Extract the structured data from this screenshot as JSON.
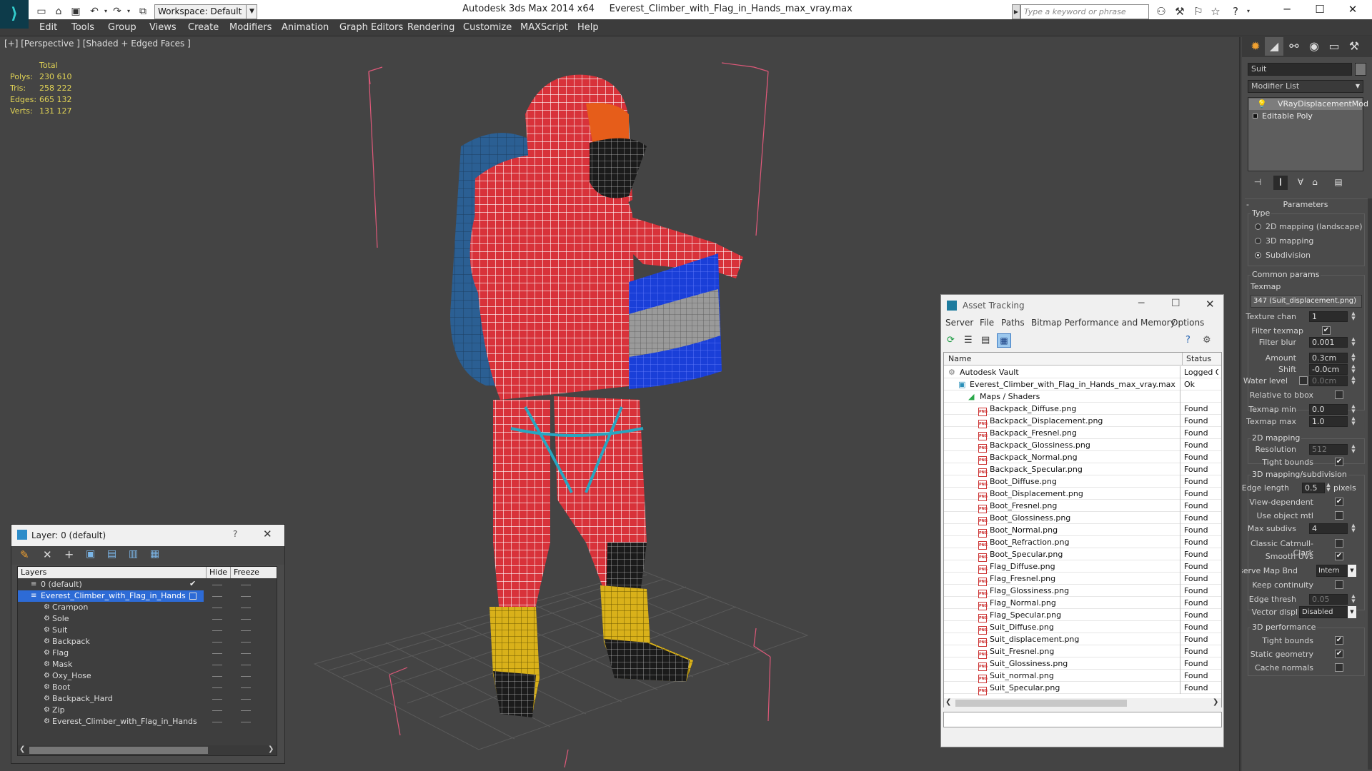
{
  "titlebar": {
    "app_title": "Autodesk 3ds Max  2014 x64",
    "file_name": "Everest_Climber_with_Flag_in_Hands_max_vray.max",
    "workspace": "Workspace: Default",
    "search_placeholder": "Type a keyword or phrase"
  },
  "menu": [
    "Edit",
    "Tools",
    "Group",
    "Views",
    "Create",
    "Modifiers",
    "Animation",
    "Graph Editors",
    "Rendering",
    "Customize",
    "MAXScript",
    "Help"
  ],
  "viewport": {
    "label": "[+] [Perspective ] [Shaded + Edged Faces ]",
    "stats": {
      "header": "Total",
      "rows": [
        {
          "label": "Polys:",
          "value": "230 610"
        },
        {
          "label": "Tris:",
          "value": "258 222"
        },
        {
          "label": "Edges:",
          "value": "665 132"
        },
        {
          "label": "Verts:",
          "value": "131 127"
        }
      ]
    }
  },
  "command_panel": {
    "object_name": "Suit",
    "modifier_list": "Modifier List",
    "stack": [
      "VRayDisplacementMod",
      "Editable Poly"
    ],
    "parameters": {
      "title": "Parameters",
      "type_label": "Type",
      "types": [
        "2D mapping (landscape)",
        "3D mapping",
        "Subdivision"
      ],
      "selected_type": 2,
      "common_label": "Common params",
      "texmap_label": "Texmap",
      "texmap_value": "347 (Suit_displacement.png)",
      "texture_chan_label": "Texture chan",
      "texture_chan": "1",
      "filter_texmap_label": "Filter texmap",
      "filter_blur_label": "Filter blur",
      "filter_blur": "0.001",
      "amount_label": "Amount",
      "amount": "0.3cm",
      "shift_label": "Shift",
      "shift": "-0.0cm",
      "water_level_label": "Water level",
      "water_level": "0.0cm",
      "relative_bbox_label": "Relative to bbox",
      "texmap_min_label": "Texmap min",
      "texmap_min": "0.0",
      "texmap_max_label": "Texmap max",
      "texmap_max": "1.0",
      "mapping2d_label": "2D mapping",
      "resolution_label": "Resolution",
      "resolution": "512",
      "tight_bounds_label": "Tight bounds",
      "mapping3d_label": "3D mapping/subdivision",
      "edge_length_label": "Edge length",
      "edge_length": "0.5",
      "pixels_label": "pixels",
      "view_dependent_label": "View-dependent",
      "use_object_mtl_label": "Use object mtl",
      "max_subdivs_label": "Max subdivs",
      "max_subdivs": "4",
      "catmull_label": "Classic Catmull-Clark",
      "smooth_uvs_label": "Smooth UVs",
      "preserve_label": "Preserve Map Bnd",
      "preserve_value": "Intern",
      "keep_continuity_label": "Keep continuity",
      "edge_thresh_label": "Edge thresh",
      "edge_thresh": "0.05",
      "vector_disp_label": "Vector displ",
      "vector_disp_value": "Disabled",
      "perf_label": "3D performance",
      "perf_tight_label": "Tight bounds",
      "static_geom_label": "Static geometry",
      "cache_normals_label": "Cache normals"
    }
  },
  "layers": {
    "title": "Layer: 0 (default)",
    "help": "?",
    "col_layers": "Layers",
    "col_hide": "Hide",
    "col_freeze": "Freeze",
    "rows": [
      {
        "name": "0 (default)",
        "level": 0,
        "kind": "layer"
      },
      {
        "name": "Everest_Climber_with_Flag_in_Hands",
        "level": 0,
        "kind": "layer",
        "selected": true
      },
      {
        "name": "Crampon",
        "level": 1,
        "kind": "object"
      },
      {
        "name": "Sole",
        "level": 1,
        "kind": "object"
      },
      {
        "name": "Suit",
        "level": 1,
        "kind": "object"
      },
      {
        "name": "Backpack",
        "level": 1,
        "kind": "object"
      },
      {
        "name": "Flag",
        "level": 1,
        "kind": "object"
      },
      {
        "name": "Mask",
        "level": 1,
        "kind": "object"
      },
      {
        "name": "Oxy_Hose",
        "level": 1,
        "kind": "object"
      },
      {
        "name": "Boot",
        "level": 1,
        "kind": "object"
      },
      {
        "name": "Backpack_Hard",
        "level": 1,
        "kind": "object"
      },
      {
        "name": "Zip",
        "level": 1,
        "kind": "object"
      },
      {
        "name": "Everest_Climber_with_Flag_in_Hands",
        "level": 1,
        "kind": "object"
      }
    ]
  },
  "asset_tracking": {
    "title": "Asset Tracking",
    "menu": [
      "Server",
      "File",
      "Paths",
      "Bitmap Performance and Memory",
      "Options"
    ],
    "col_name": "Name",
    "col_status": "Status",
    "rows": [
      {
        "name": "Autodesk Vault",
        "status": "Logged O",
        "level": 0,
        "kind": "vault"
      },
      {
        "name": "Everest_Climber_with_Flag_in_Hands_max_vray.max",
        "status": "Ok",
        "level": 1,
        "kind": "max"
      },
      {
        "name": "Maps / Shaders",
        "status": "",
        "level": 2,
        "kind": "folder"
      },
      {
        "name": "Backpack_Diffuse.png",
        "status": "Found",
        "level": 3,
        "kind": "png"
      },
      {
        "name": "Backpack_Displacement.png",
        "status": "Found",
        "level": 3,
        "kind": "png"
      },
      {
        "name": "Backpack_Fresnel.png",
        "status": "Found",
        "level": 3,
        "kind": "png"
      },
      {
        "name": "Backpack_Glossiness.png",
        "status": "Found",
        "level": 3,
        "kind": "png"
      },
      {
        "name": "Backpack_Normal.png",
        "status": "Found",
        "level": 3,
        "kind": "png"
      },
      {
        "name": "Backpack_Specular.png",
        "status": "Found",
        "level": 3,
        "kind": "png"
      },
      {
        "name": "Boot_Diffuse.png",
        "status": "Found",
        "level": 3,
        "kind": "png"
      },
      {
        "name": "Boot_Displacement.png",
        "status": "Found",
        "level": 3,
        "kind": "png"
      },
      {
        "name": "Boot_Fresnel.png",
        "status": "Found",
        "level": 3,
        "kind": "png"
      },
      {
        "name": "Boot_Glossiness.png",
        "status": "Found",
        "level": 3,
        "kind": "png"
      },
      {
        "name": "Boot_Normal.png",
        "status": "Found",
        "level": 3,
        "kind": "png"
      },
      {
        "name": "Boot_Refraction.png",
        "status": "Found",
        "level": 3,
        "kind": "png"
      },
      {
        "name": "Boot_Specular.png",
        "status": "Found",
        "level": 3,
        "kind": "png"
      },
      {
        "name": "Flag_Diffuse.png",
        "status": "Found",
        "level": 3,
        "kind": "png"
      },
      {
        "name": "Flag_Fresnel.png",
        "status": "Found",
        "level": 3,
        "kind": "png"
      },
      {
        "name": "Flag_Glossiness.png",
        "status": "Found",
        "level": 3,
        "kind": "png"
      },
      {
        "name": "Flag_Normal.png",
        "status": "Found",
        "level": 3,
        "kind": "png"
      },
      {
        "name": "Flag_Specular.png",
        "status": "Found",
        "level": 3,
        "kind": "png"
      },
      {
        "name": "Suit_Diffuse.png",
        "status": "Found",
        "level": 3,
        "kind": "png"
      },
      {
        "name": "Suit_displacement.png",
        "status": "Found",
        "level": 3,
        "kind": "png"
      },
      {
        "name": "Suit_Fresnel.png",
        "status": "Found",
        "level": 3,
        "kind": "png"
      },
      {
        "name": "Suit_Glossiness.png",
        "status": "Found",
        "level": 3,
        "kind": "png"
      },
      {
        "name": "Suit_normal.png",
        "status": "Found",
        "level": 3,
        "kind": "png"
      },
      {
        "name": "Suit_Specular.png",
        "status": "Found",
        "level": 3,
        "kind": "png"
      }
    ]
  },
  "colors": {
    "viewport_bg": "#444444",
    "selection": "#2d6bd6",
    "stats_text": "#e2d455",
    "bbox": "#e0597a",
    "suit": "#d8323a",
    "backpack": "#2b5f93",
    "flag": "#1a3fd8",
    "boot": "#d9b11a"
  }
}
